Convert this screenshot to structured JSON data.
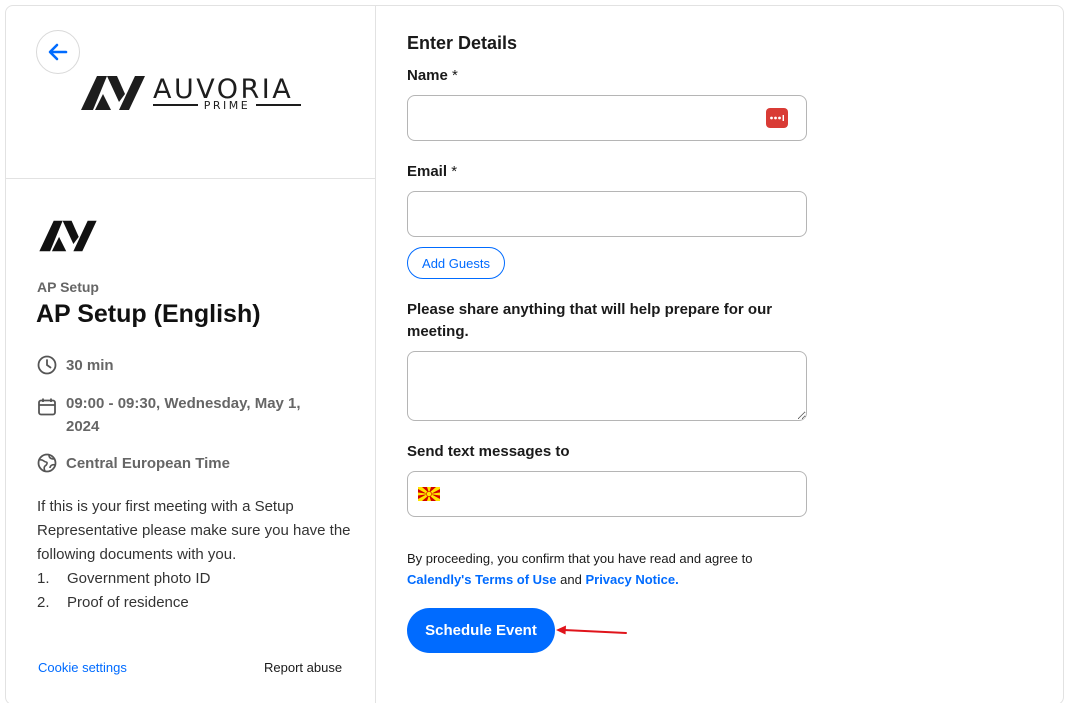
{
  "brand": {
    "name": "AUVORIA",
    "sub": "PRIME"
  },
  "event": {
    "kicker": "AP Setup",
    "title": "AP Setup (English)",
    "duration": "30 min",
    "datetime": "09:00 - 09:30, Wednesday, May 1, 2024",
    "timezone": "Central European Time",
    "description": "If this is your first meeting with a Setup Representative please make sure you have the following documents with you.",
    "documents": [
      {
        "num": "1.",
        "text": "Government photo ID"
      },
      {
        "num": "2.",
        "text": "Proof of residence"
      }
    ]
  },
  "footer": {
    "cookie": "Cookie settings",
    "report": "Report abuse"
  },
  "form": {
    "heading": "Enter Details",
    "name_label": "Name",
    "name_value": "",
    "email_label": "Email",
    "email_value": "",
    "required_mark": "*",
    "add_guests": "Add Guests",
    "prepare_label": "Please share anything that will help prepare for our meeting.",
    "prepare_value": "",
    "sms_label": "Send text messages to",
    "sms_value": "",
    "consent_prefix": "By proceeding, you confirm that you have read and agree to",
    "terms_link": "Calendly's Terms of Use",
    "consent_and": "and",
    "privacy_link": "Privacy Notice.",
    "submit": "Schedule Event"
  },
  "colors": {
    "accent": "#006bff",
    "annotation": "#e0141b",
    "password_manager": "#d93b35"
  },
  "icons": {
    "back": "arrow-left-icon",
    "duration": "clock-icon",
    "datetime": "calendar-icon",
    "timezone": "globe-icon",
    "password": "password-manager-icon",
    "flag": "north-macedonia-flag-icon"
  }
}
